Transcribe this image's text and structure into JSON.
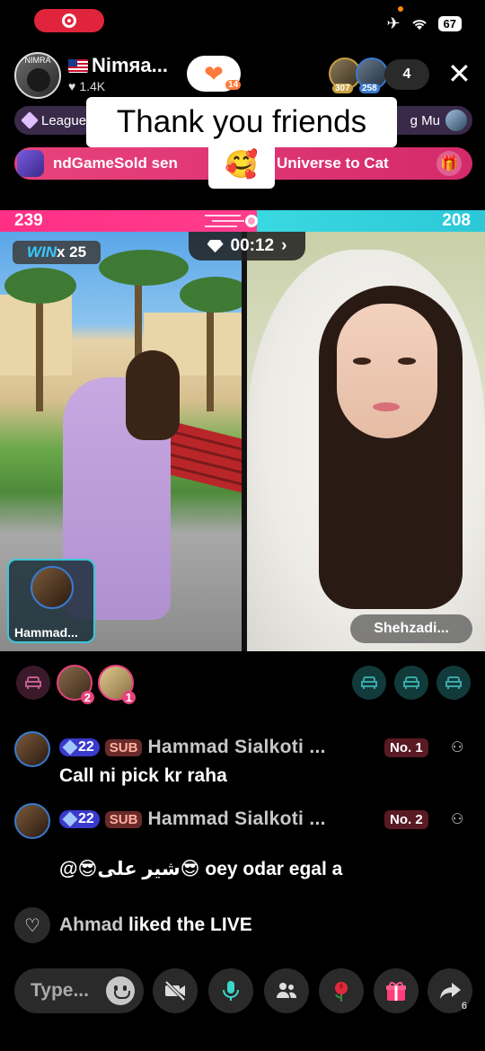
{
  "status": {
    "battery": "67"
  },
  "host": {
    "name": "Nimяa...",
    "avatar_tag": "NIMRA",
    "likes": "1.4K",
    "follow_hearts": "14"
  },
  "viewers": {
    "avatar1_num": "307",
    "avatar2_num": "258",
    "count": "4"
  },
  "league": {
    "label": "League",
    "right_label": "g Mu"
  },
  "gift_banner": {
    "text_left": "ndGameSold sen",
    "text_right": "Universe to Cat"
  },
  "caption": {
    "text": "Thank you friends",
    "emoji": "🥰"
  },
  "battle": {
    "left_score": "239",
    "right_score": "208",
    "left_share": 0.53,
    "win_prefix": "WIN",
    "win_multiplier": "x 25",
    "timer": "00:12",
    "guest_name": "Hammad...",
    "host_panel_name": "Shehzadi..."
  },
  "gifters": [
    {
      "rank": "2"
    },
    {
      "rank": "1"
    }
  ],
  "comments": [
    {
      "level": "22",
      "sub": "SUB",
      "name": "Hammad  Sialkoti ...",
      "no": "No. 1",
      "text": "Call ni pick kr raha"
    },
    {
      "level": "22",
      "sub": "SUB",
      "name": "Hammad  Sialkoti ...",
      "no": "No. 2",
      "text": "@😎شیر علی😎 oey odar egal a"
    }
  ],
  "liked": {
    "name": "Ahmad",
    "text": "liked the LIVE"
  },
  "bottom": {
    "placeholder": "Type...",
    "share_count": "6"
  },
  "colors": {
    "pink": "#ff2f86",
    "teal": "#2cc8d8",
    "record": "#e0243c"
  }
}
